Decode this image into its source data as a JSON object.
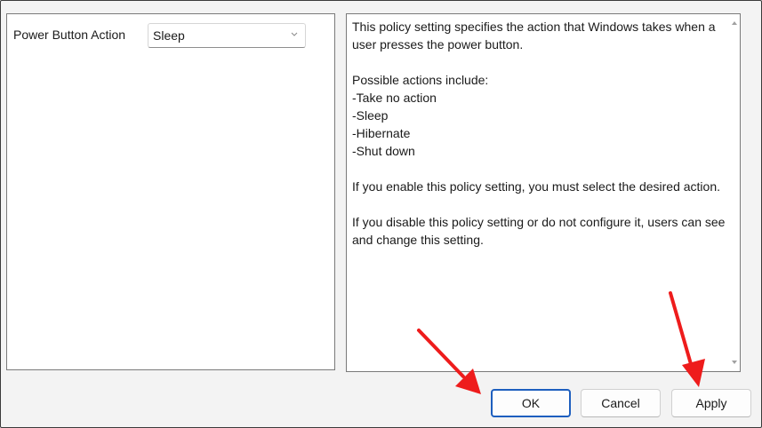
{
  "setting": {
    "label": "Power Button Action",
    "selected_value": "Sleep"
  },
  "help": {
    "text": "This policy setting specifies the action that Windows takes when a user presses the power button.\n\nPossible actions include:\n-Take no action\n-Sleep\n-Hibernate\n-Shut down\n\nIf you enable this policy setting, you must select the desired action.\n\nIf you disable this policy setting or do not configure it, users can see and change this setting."
  },
  "buttons": {
    "ok_label": "OK",
    "cancel_label": "Cancel",
    "apply_label": "Apply"
  },
  "colors": {
    "annotation_arrow": "#ee1c1c",
    "focus_border": "#1e5fbf"
  },
  "icons": {
    "select_chevron": "chevron-down-icon",
    "scroll_up": "scroll-up-arrow-icon",
    "scroll_down": "scroll-down-arrow-icon",
    "annotation": "red-arrow-icon"
  }
}
